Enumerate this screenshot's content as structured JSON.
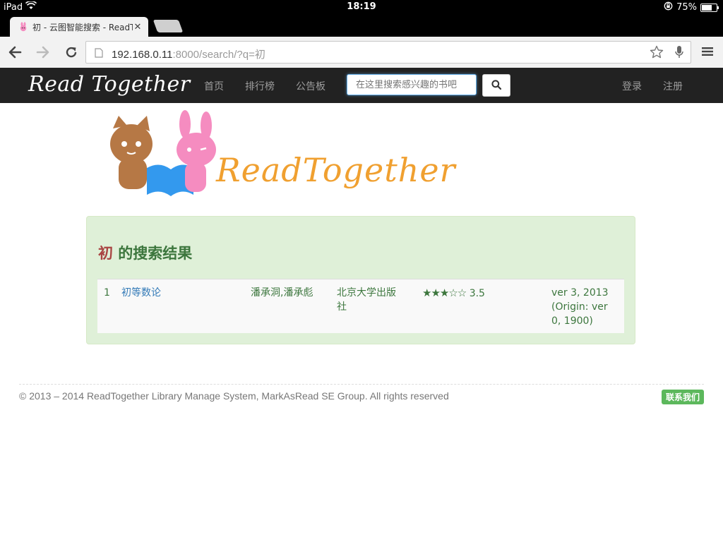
{
  "status_bar": {
    "device": "iPad",
    "time": "18:19",
    "battery": "75%",
    "battery_level": 0.75
  },
  "browser": {
    "tab_title": "初 - 云图智能搜索 - ReadT",
    "url_host": "192.168.0.11",
    "url_rest": ":8000/search/?q=初"
  },
  "navbar": {
    "brand": "Read Together",
    "links": [
      "首页",
      "排行榜",
      "公告板"
    ],
    "search_placeholder": "在这里搜索感兴趣的书吧",
    "login": "登录",
    "register": "注册"
  },
  "logo": {
    "text": "ReadTogether"
  },
  "results": {
    "keyword": "初",
    "title_suffix": " 的搜索结果",
    "rows": [
      {
        "index": "1",
        "title": "初等数论",
        "authors": "潘承洞,潘承彪",
        "publisher": "北京大学出版社",
        "stars": "★★★☆☆",
        "rating": "3.5",
        "rating_value": 3.5,
        "date": "ver 3, 2013 (Origin: ver 0, 1900)"
      }
    ]
  },
  "footer": {
    "copyright": "© 2013 – 2014 ReadTogether Library Manage System, MarkAsRead SE Group. All rights reserved",
    "contact": "联系我们"
  },
  "colors": {
    "navbar_bg": "#222222",
    "panel_bg": "#dff0d8",
    "panel_text": "#3c763d",
    "keyword": "#a94442",
    "link": "#337ab7",
    "contact_btn": "#5cb85c"
  }
}
